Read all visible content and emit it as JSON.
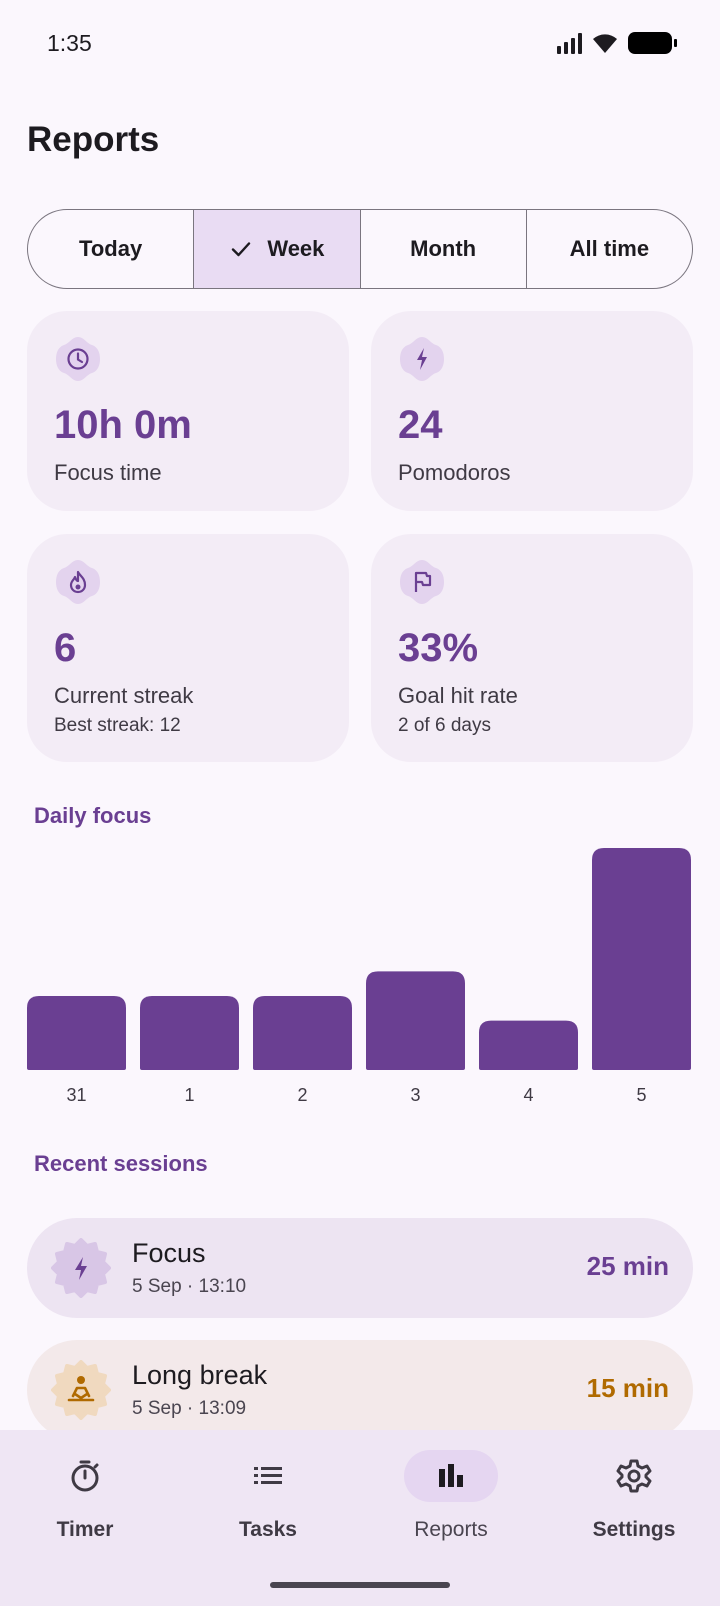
{
  "status": {
    "time": "1:35"
  },
  "page": {
    "title": "Reports"
  },
  "periods": [
    {
      "label": "Today",
      "selected": false
    },
    {
      "label": "Week",
      "selected": true
    },
    {
      "label": "Month",
      "selected": false
    },
    {
      "label": "All time",
      "selected": false
    }
  ],
  "stats": {
    "focus": {
      "icon": "clock-icon",
      "value": "10h 0m",
      "label": "Focus time"
    },
    "pomodoros": {
      "icon": "bolt-icon",
      "value": "24",
      "label": "Pomodoros"
    },
    "streak": {
      "icon": "flame-icon",
      "value": "6",
      "label": "Current streak",
      "sub": "Best streak: 12"
    },
    "goal": {
      "icon": "flag-icon",
      "value": "33%",
      "label": "Goal hit rate",
      "sub": "2 of 6 days"
    }
  },
  "daily_title": "Daily focus",
  "chart_data": {
    "type": "bar",
    "categories": [
      "31",
      "1",
      "2",
      "3",
      "4",
      "5"
    ],
    "values": [
      75,
      75,
      75,
      100,
      50,
      225
    ],
    "title": "",
    "xlabel": "",
    "ylabel": "",
    "ylim": [
      0,
      225
    ],
    "grid": false,
    "color": "#6a3f92"
  },
  "recent_title": "Recent sessions",
  "sessions": [
    {
      "icon": "bolt-icon",
      "title": "Focus",
      "time": "5 Sep · 13:10",
      "duration": "25 min",
      "color": "#6a3f92",
      "bg": "#ede4f2"
    },
    {
      "icon": "meditation-icon",
      "title": "Long break",
      "time": "5 Sep · 13:09",
      "duration": "15 min",
      "color": "#b06a00",
      "bg": "#f3e9ea"
    }
  ],
  "nav": [
    {
      "icon": "timer-icon",
      "label": "Timer",
      "active": false
    },
    {
      "icon": "list-icon",
      "label": "Tasks",
      "active": false
    },
    {
      "icon": "bar-chart-icon",
      "label": "Reports",
      "active": true
    },
    {
      "icon": "gear-icon",
      "label": "Settings",
      "active": false
    }
  ]
}
